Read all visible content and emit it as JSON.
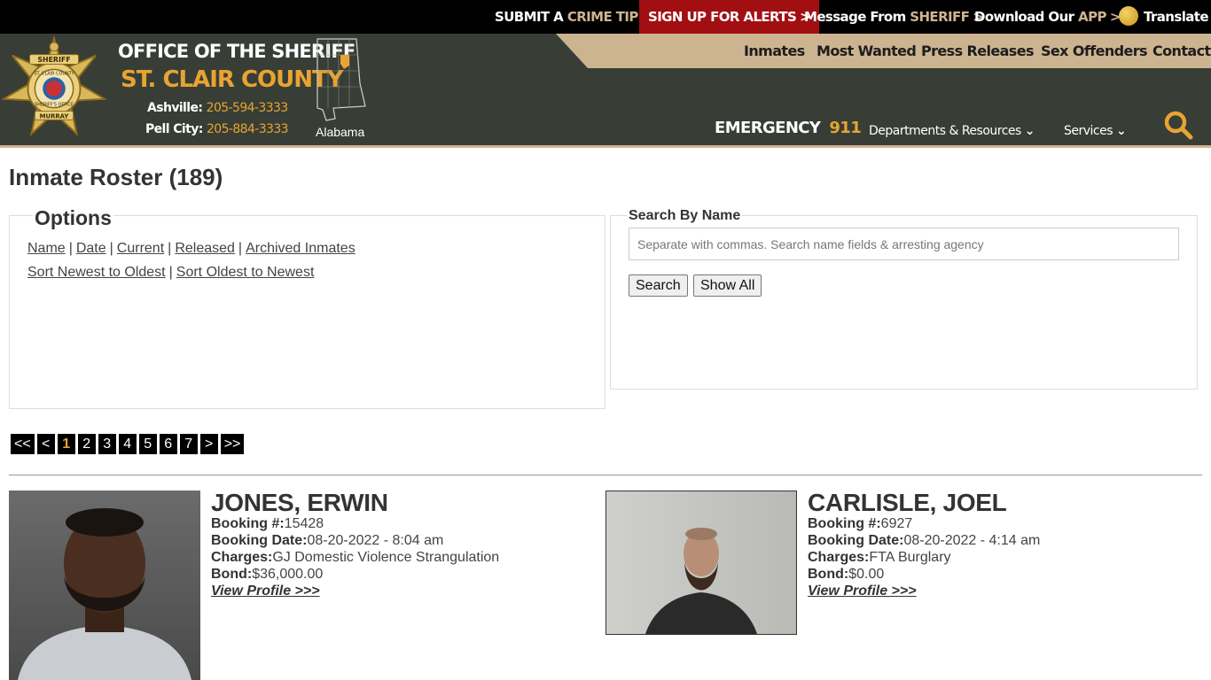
{
  "topbar": {
    "crime_tip": {
      "pre": "SUBMIT A ",
      "hl": "CRIME TIP"
    },
    "alerts": "SIGN UP FOR ALERTS",
    "message": {
      "pre": "Message From ",
      "hl": "SHERIFF"
    },
    "download": {
      "pre": "Download Our ",
      "hl": "APP"
    },
    "translate": "Translate",
    "chevron": ">"
  },
  "header": {
    "office_title": "OFFICE OF THE SHERIFF",
    "county": "ST. CLAIR COUNTY",
    "phones": [
      {
        "city": "Ashville:",
        "number": "205-594-3333"
      },
      {
        "city": "Pell City:",
        "number": "205-884-3333"
      }
    ],
    "state_label": "Alabama",
    "badge_text": {
      "top": "SHERIFF",
      "ring": "ST. CLAIR COUNTY",
      "ring_bottom": "SHERIFF'S OFFICE",
      "bottom": "MURRAY"
    },
    "nav": [
      "Inmates",
      "Most Wanted",
      "Press Releases",
      "Sex Offenders",
      "Contact"
    ],
    "emergency": {
      "label": "EMERGENCY",
      "number": "911"
    },
    "dropdowns": [
      {
        "label": "Departments & Resources",
        "arrow": "⌄"
      },
      {
        "label": "Services",
        "arrow": "⌄"
      }
    ]
  },
  "colors": {
    "header_bg": "#383e36",
    "tan": "#cdb491",
    "gold": "#e8a431",
    "alert_red": "#a10f13"
  },
  "main": {
    "title": "Inmate Roster (189)",
    "options": {
      "legend": "Options",
      "filters": [
        "Name",
        "Date",
        "Current",
        "Released",
        "Archived Inmates"
      ],
      "sorts": [
        "Sort Newest to Oldest",
        "Sort Oldest to Newest"
      ],
      "separator": "|"
    },
    "search": {
      "legend": "Search By Name",
      "placeholder": "Separate with commas. Search name fields & arresting agency",
      "value": "",
      "search_button": "Search",
      "show_all_button": "Show All"
    },
    "pager": {
      "first": "<<",
      "prev": "<",
      "next": ">",
      "last": ">>",
      "pages": [
        "1",
        "2",
        "3",
        "4",
        "5",
        "6",
        "7"
      ],
      "current": "1"
    },
    "inmates": [
      {
        "name": "JONES, ERWIN",
        "booking_label": "Booking #:",
        "booking": "15428",
        "date_label": "Booking Date:",
        "date": "08-20-2022 - 8:04 am",
        "charges_label": "Charges:",
        "charges": "GJ Domestic Violence Strangulation",
        "bond_label": "Bond:",
        "bond": "$36,000.00",
        "link": "View Profile >>>"
      },
      {
        "name": "CARLISLE, JOEL",
        "booking_label": "Booking #:",
        "booking": "6927",
        "date_label": "Booking Date:",
        "date": "08-20-2022 - 4:14 am",
        "charges_label": "Charges:",
        "charges": "FTA Burglary",
        "bond_label": "Bond:",
        "bond": "$0.00",
        "link": "View Profile >>>"
      }
    ]
  }
}
